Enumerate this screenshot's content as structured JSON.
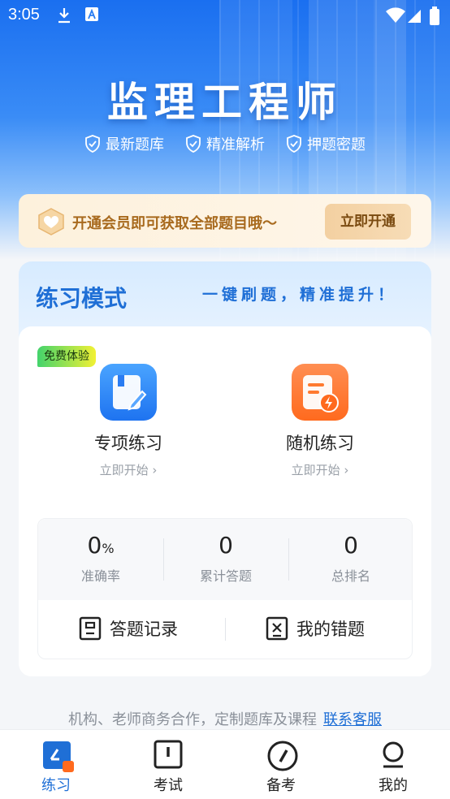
{
  "status_bar": {
    "time": "3:05"
  },
  "hero": {
    "title": "监理工程师",
    "features": [
      "最新题库",
      "精准解析",
      "押题密题"
    ]
  },
  "vip_banner": {
    "text": "开通会员即可获取全部题目哦～",
    "button": "立即开通"
  },
  "practice": {
    "title": "练习模式",
    "slogan": "一键刷题，精准提升！",
    "free_tag": "免费体验",
    "modes": [
      {
        "name": "专项练习",
        "action": "立即开始 ›"
      },
      {
        "name": "随机练习",
        "action": "立即开始 ›"
      }
    ],
    "stats": [
      {
        "value": "0",
        "unit": "%",
        "label": "准确率"
      },
      {
        "value": "0",
        "unit": "",
        "label": "累计答题"
      },
      {
        "value": "0",
        "unit": "",
        "label": "总排名"
      }
    ],
    "actions": [
      {
        "label": "答题记录"
      },
      {
        "label": "我的错题"
      }
    ]
  },
  "cooperation": {
    "text": "机构、老师商务合作，定制题库及课程",
    "link": "联系客服"
  },
  "tabbar": {
    "tabs": [
      {
        "label": "练习",
        "active": true
      },
      {
        "label": "考试",
        "active": false
      },
      {
        "label": "备考",
        "active": false
      },
      {
        "label": "我的",
        "active": false
      }
    ]
  },
  "colors": {
    "primary": "#1f6fd6",
    "vip_text": "#a86a1e",
    "orange": "#ff6a1e"
  }
}
